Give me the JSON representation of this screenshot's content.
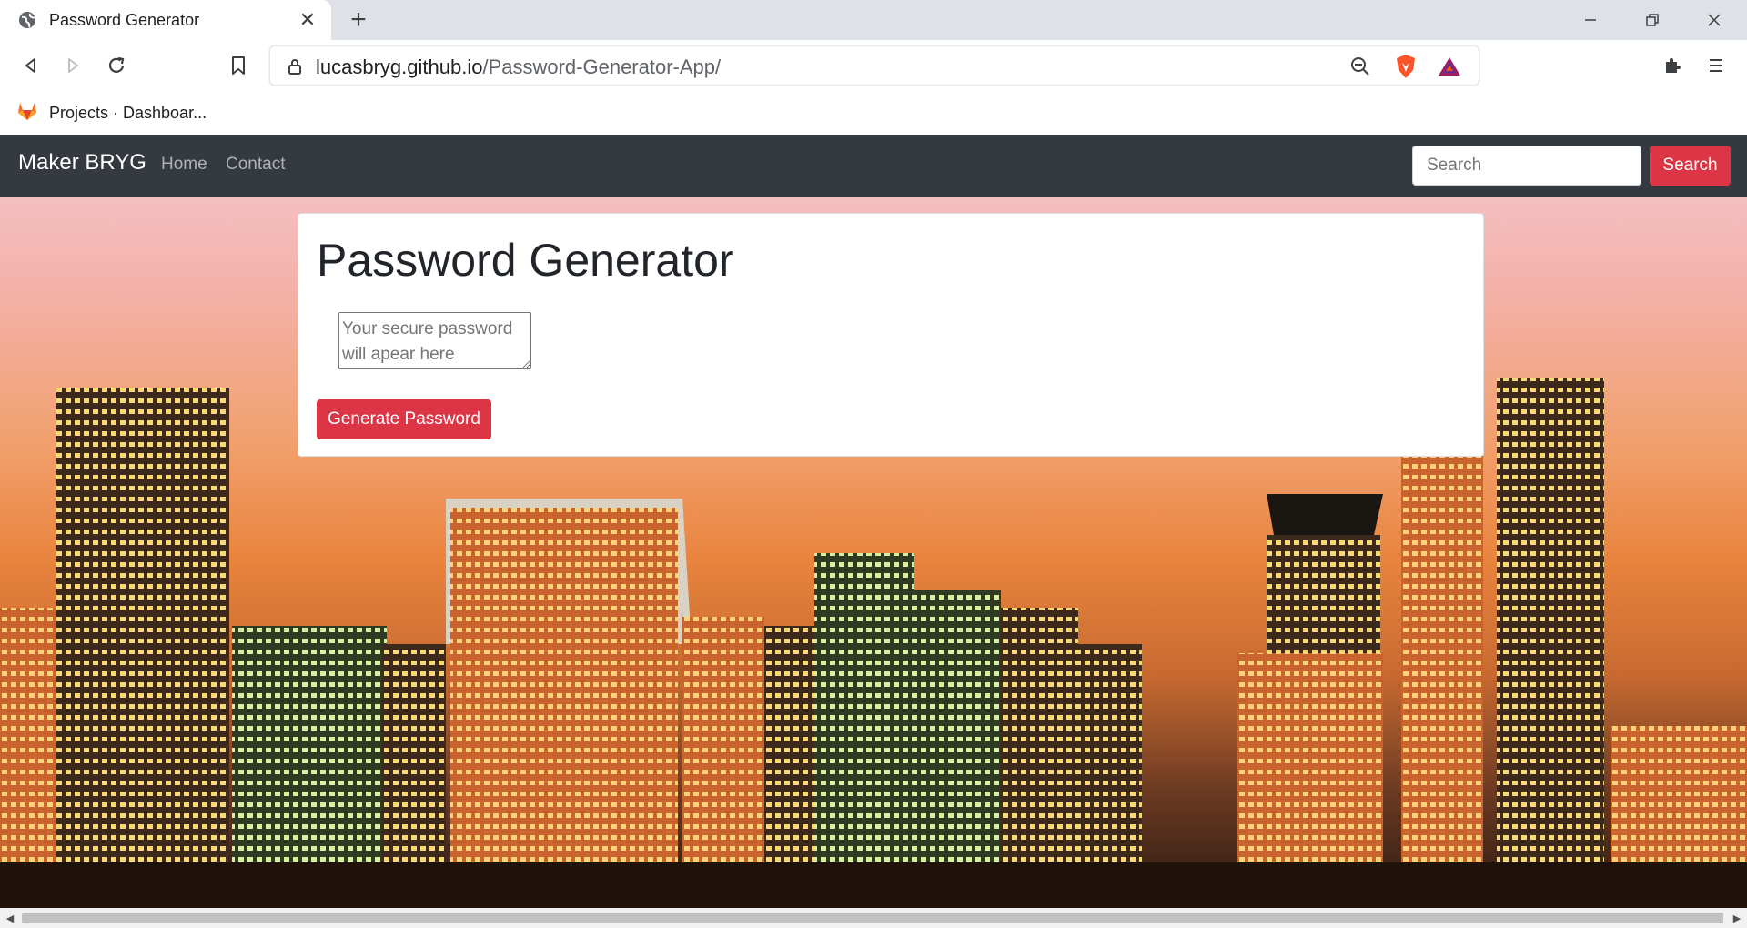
{
  "browser": {
    "tab_title": "Password Generator",
    "url_host": "lucasbryg.github.io",
    "url_path": "/Password-Generator-App/",
    "bookmark_label": "Projects · Dashboar..."
  },
  "navbar": {
    "brand": "Maker BRYG",
    "links": [
      "Home",
      "Contact"
    ],
    "search_placeholder": "Search",
    "search_button": "Search"
  },
  "card": {
    "title": "Password Generator",
    "password_placeholder": "Your secure password will apear here",
    "generate_button": "Generate Password"
  },
  "colors": {
    "navbar_bg": "#343a40",
    "accent_red": "#dc3545"
  },
  "icons": [
    "globe-icon",
    "close-icon",
    "plus-icon",
    "minimize-icon",
    "restore-icon",
    "back-icon",
    "forward-icon",
    "reload-icon",
    "bookmark-icon",
    "lock-icon",
    "zoom-out-icon",
    "brave-shield-icon",
    "bat-rewards-icon",
    "extensions-icon",
    "menu-icon",
    "gitlab-icon"
  ]
}
